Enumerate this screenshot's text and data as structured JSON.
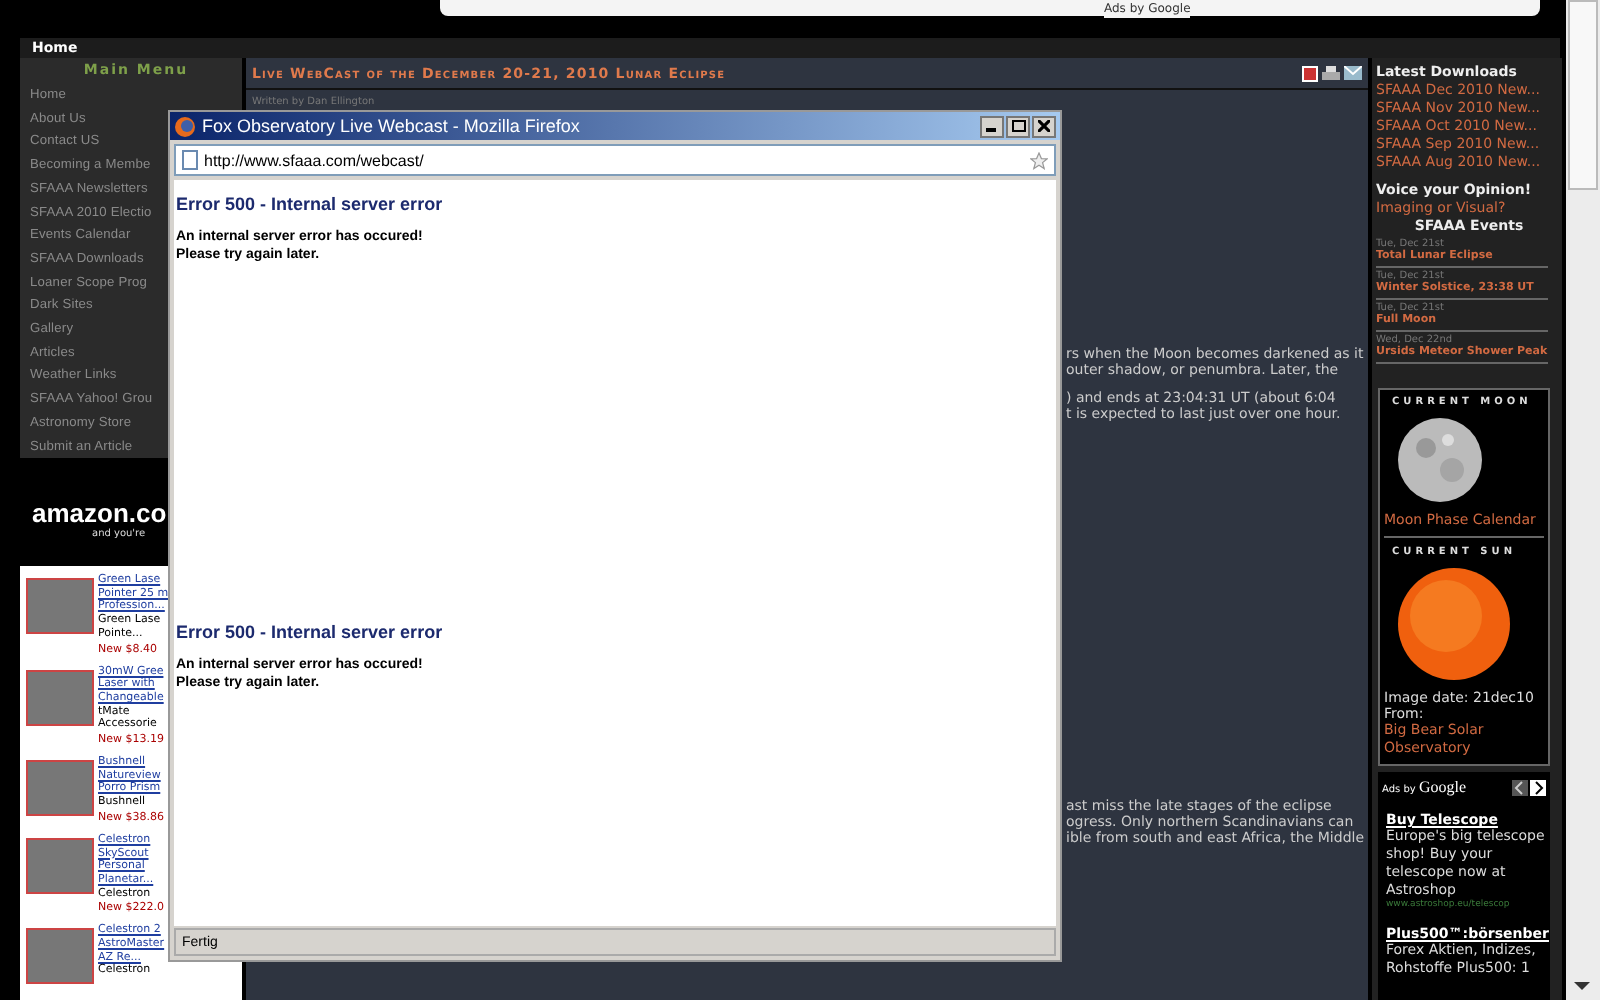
{
  "top_bar": {
    "ad_label": "Ads by Google"
  },
  "nav": {
    "items": [
      {
        "label": "Home",
        "selected": true
      }
    ]
  },
  "main_menu": {
    "title": "Main Menu",
    "items": [
      "Home",
      "About Us",
      "Contact US",
      "Becoming a Membe",
      "SFAAA Newsletters",
      "SFAAA 2010 Electio",
      "Events Calendar",
      "SFAAA Downloads",
      "Loaner Scope Prog",
      "Dark Sites",
      "Gallery",
      "Articles",
      "Weather Links",
      "SFAAA Yahoo! Grou",
      "Astronomy Store",
      "Submit an Article"
    ]
  },
  "amazon": {
    "logo": "amazon.co",
    "tagline": "and you're",
    "products": [
      {
        "title_lines": [
          "Green Lase",
          "Pointer 25 m",
          "Profession..."
        ],
        "brand_lines": [
          "Green Lase",
          "Pointe..."
        ],
        "price": "New $8.40"
      },
      {
        "title_lines": [
          "30mW Gree",
          "Laser with",
          "Changeable"
        ],
        "brand_lines": [
          "tMate",
          "Accessorie"
        ],
        "price": "New $13.19"
      },
      {
        "title_lines": [
          "Bushnell",
          "Natureview",
          "Porro Prism"
        ],
        "brand_lines": [
          "Bushnell"
        ],
        "price": "New $38.86"
      },
      {
        "title_lines": [
          "Celestron",
          "SkyScout",
          "Personal",
          "Planetar..."
        ],
        "brand_lines": [
          "Celestron"
        ],
        "price": "New $222.0"
      },
      {
        "title_lines": [
          "Celestron 2",
          "AstroMaster",
          "AZ Re..."
        ],
        "brand_lines": [
          "Celestron"
        ]
      }
    ]
  },
  "article": {
    "title": "Live WebCast of the December 20-21, 2010 Lunar Eclipse",
    "byline": "Written by Dan Ellington",
    "fragments": [
      [
        "rs when the Moon becomes darkened as it",
        "outer shadow, or penumbra. Later, the"
      ],
      [
        ") and ends at 23:04:31 UT (about 6:04",
        "t is expected to last just over one hour."
      ],
      [
        "ast miss the late stages of the eclipse",
        "ogress. Only northern Scandinavians can",
        "ible from south and east Africa, the Middle"
      ]
    ]
  },
  "sidebar_right": {
    "downloads_title": "Latest Downloads",
    "downloads": [
      "SFAAA Dec 2010 New...",
      "SFAAA Nov 2010 New...",
      "SFAAA Oct 2010 New...",
      "SFAAA Sep 2010 New...",
      "SFAAA Aug 2010 New..."
    ],
    "poll_title": "Voice your Opinion!",
    "poll_link": "Imaging or Visual?",
    "events_title": "SFAAA Events",
    "events": [
      {
        "date": "Tue, Dec 21st",
        "title": "Total Lunar Eclipse"
      },
      {
        "date": "Tue, Dec 21st",
        "title": "Winter Solstice, 23:38 UT"
      },
      {
        "date": "Tue, Dec 21st",
        "title": "Full Moon"
      },
      {
        "date": "Wed, Dec 22nd",
        "title": "Ursids Meteor Shower Peak"
      }
    ],
    "moon_label": "CURRENT MOON",
    "moon_link": "Moon Phase Calendar",
    "sun_label": "CURRENT SUN",
    "sun_date": "Image date: 21dec10",
    "sun_from": "From:",
    "sun_link": "Big Bear Solar Observatory",
    "ads_label": "Ads by",
    "ads_brand": "Google",
    "ads": [
      {
        "title": "Buy Telescope",
        "text": "Europe's big telescope shop! Buy your telescope now at Astroshop",
        "url": "www.astroshop.eu/telescop"
      },
      {
        "title": "Plus500™:börsenber",
        "text": "Forex Aktien, Indizes, Rohstoffe Plus500: 1"
      }
    ]
  },
  "popup": {
    "title": "Fox Observatory Live Webcast - Mozilla Firefox",
    "url": "http://www.sfaaa.com/webcast/",
    "frames": [
      {
        "heading": "Error 500 - Internal server error",
        "lines": [
          "An internal server error has occured!",
          "Please try again later."
        ]
      },
      {
        "heading": "Error 500 - Internal server error",
        "lines": [
          "An internal server error has occured!",
          "Please try again later."
        ]
      }
    ],
    "status": "Fertig"
  }
}
